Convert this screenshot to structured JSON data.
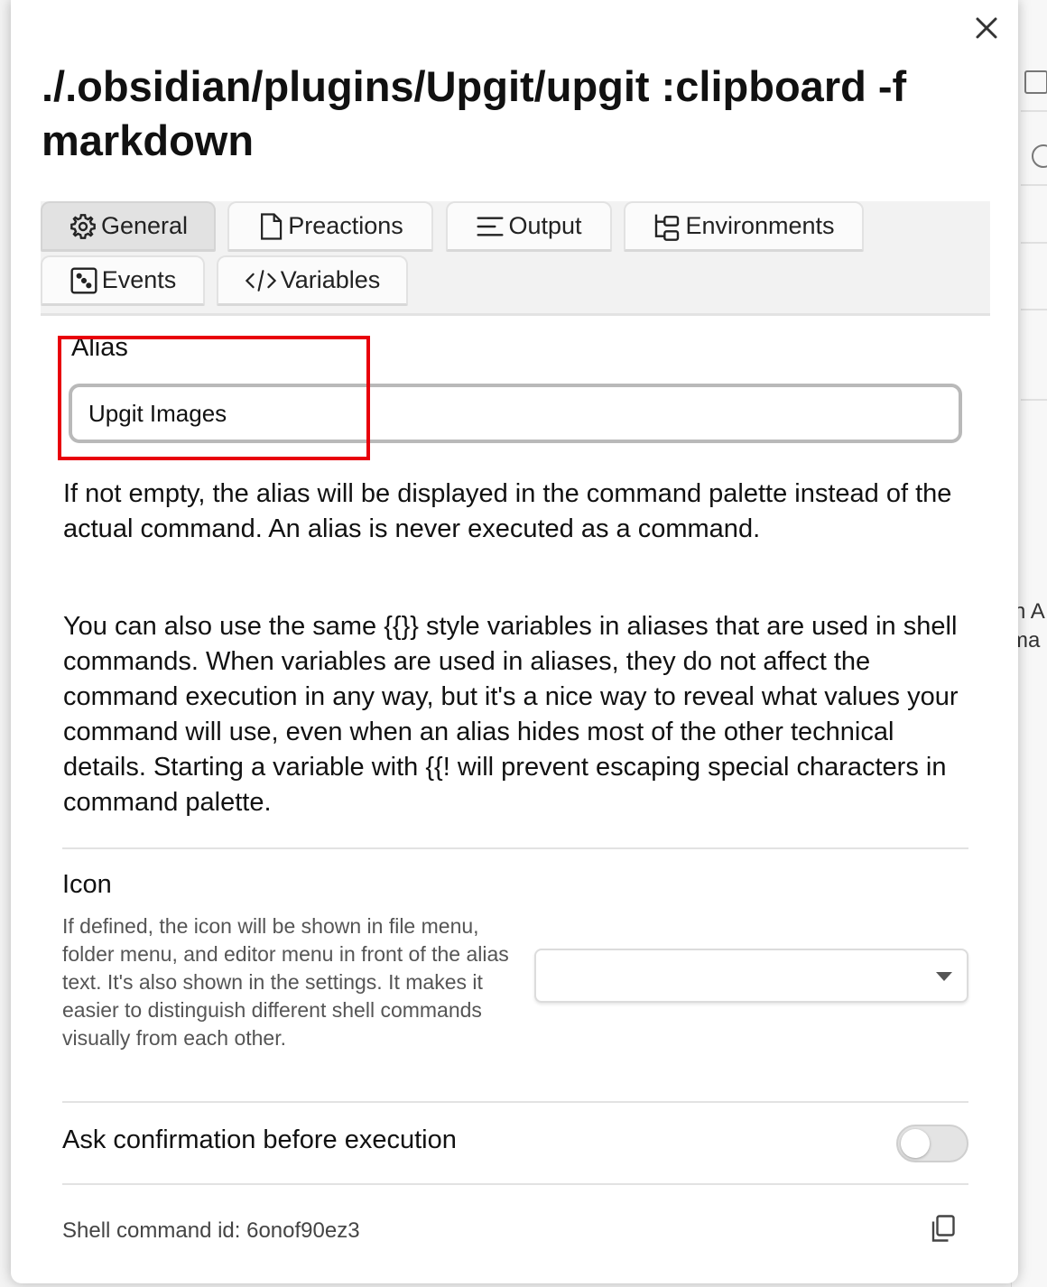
{
  "modal": {
    "title": "./.obsidian/plugins/Upgit/upgit :clipboard -f markdown"
  },
  "tabs": [
    {
      "label": "General",
      "icon": "gear-icon",
      "active": true
    },
    {
      "label": "Preactions",
      "icon": "file-icon",
      "active": false
    },
    {
      "label": "Output",
      "icon": "align-left-icon",
      "active": false
    },
    {
      "label": "Environments",
      "icon": "folder-tree-icon",
      "active": false
    },
    {
      "label": "Events",
      "icon": "dice-icon",
      "active": false
    },
    {
      "label": "Variables",
      "icon": "code-icon",
      "active": false
    }
  ],
  "alias": {
    "label": "Alias",
    "value": "Upgit Images",
    "description_1": "If not empty, the alias will be displayed in the command palette instead of the actual command. An alias is never executed as a command.",
    "description_2": "You can also use the same {{}} style variables in aliases that are used in shell commands. When variables are used in aliases, they do not affect the command execution in any way, but it's a nice way to reveal what values your command will use, even when an alias hides most of the other technical details. Starting a variable with {{! will prevent escaping special characters in command palette."
  },
  "icon_setting": {
    "label": "Icon",
    "description": "If defined, the icon will be shown in file menu, folder menu, and editor menu in front of the alias text. It's also shown in the settings. It makes it easier to distinguish different shell commands visually from each other.",
    "selected": ""
  },
  "confirmation": {
    "label": "Ask confirmation before execution",
    "enabled": false
  },
  "footer": {
    "shell_command_id": "Shell command id: 6onof90ez3"
  },
  "background": {
    "fragment_1": "n A",
    "fragment_2": "ma"
  }
}
